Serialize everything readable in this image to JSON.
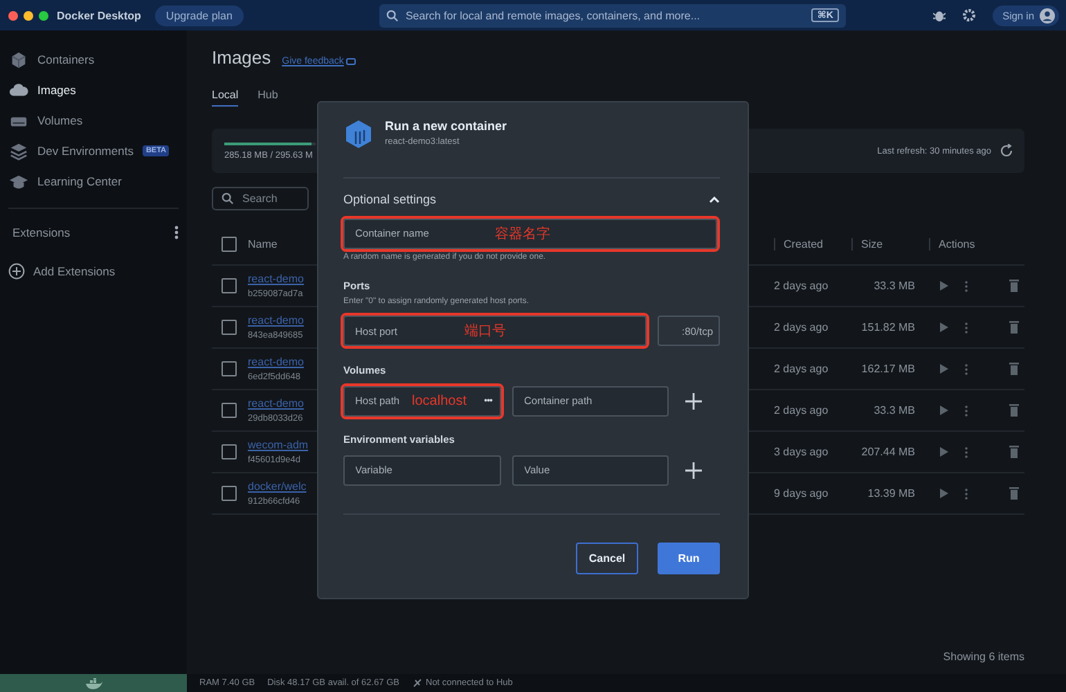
{
  "window": {
    "title": "Docker Desktop"
  },
  "topbar": {
    "upgrade": "Upgrade plan",
    "search": {
      "placeholder": "Search for local and remote images, containers, and more..."
    },
    "shortcut": "⌘K",
    "sign_in": "Sign in"
  },
  "sidebar": {
    "items": [
      {
        "label": "Containers",
        "selected": false
      },
      {
        "label": "Images",
        "selected": true
      },
      {
        "label": "Volumes",
        "selected": false
      },
      {
        "label": "Dev Environments",
        "selected": false,
        "badge": "BETA"
      },
      {
        "label": "Learning Center",
        "selected": false
      }
    ],
    "extensions": {
      "title": "Extensions",
      "add": "Add Extensions"
    }
  },
  "page": {
    "title": "Images",
    "feedback": "Give feedback",
    "tabs": [
      {
        "label": "Local",
        "selected": true
      },
      {
        "label": "Hub",
        "selected": false
      }
    ],
    "storage": {
      "reading": "285.18 MB / 295.63 M",
      "level": 0.96,
      "refresh": "Last refresh: 30 minutes ago"
    },
    "search": {
      "placeholder": "Search"
    },
    "table": {
      "columns": [
        "Name",
        "Created",
        "Size",
        "Actions"
      ],
      "header_checked": false,
      "rows": [
        {
          "name": "react-demo",
          "id": "b259087ad7a",
          "created": "2 days ago",
          "size": "33.3 MB",
          "checked": false
        },
        {
          "name": "react-demo",
          "id": "843ea849685",
          "created": "2 days ago",
          "size": "151.82 MB",
          "checked": false
        },
        {
          "name": "react-demo",
          "id": "6ed2f5dd648",
          "created": "2 days ago",
          "size": "162.17 MB",
          "checked": false
        },
        {
          "name": "react-demo",
          "id": "29db8033d26",
          "created": "2 days ago",
          "size": "33.3 MB",
          "checked": false
        },
        {
          "name": "wecom-adm",
          "id": "f45601d9e4d",
          "created": "3 days ago",
          "size": "207.44 MB",
          "checked": false
        },
        {
          "name": "docker/welc",
          "id": "912b66cfd46",
          "created": "9 days ago",
          "size": "13.39 MB",
          "checked": false
        }
      ]
    },
    "footer": "Showing 6 items"
  },
  "dialog": {
    "title": "Run a new container",
    "subtitle": "react-demo3:latest",
    "section": {
      "title": "Optional settings",
      "expanded": true
    },
    "container_name": {
      "placeholder": "Container name",
      "annotation": "容器名字",
      "highlighted": true
    },
    "name_hint": "A random name is generated if you do not provide one.",
    "ports": {
      "title": "Ports",
      "hint": "Enter \"0\" to assign randomly generated host ports.",
      "host_port": {
        "placeholder": "Host port",
        "annotation": "端口号",
        "highlighted": true
      },
      "container_port": ":80/tcp"
    },
    "volumes": {
      "title": "Volumes",
      "host_path": {
        "placeholder": "Host path",
        "annotation": "localhost",
        "highlighted": true,
        "browse": "•••"
      },
      "container_path": {
        "placeholder": "Container path",
        "highlighted": false
      }
    },
    "env": {
      "title": "Environment variables",
      "variable": {
        "placeholder": "Variable",
        "highlighted": false
      },
      "value": {
        "placeholder": "Value",
        "highlighted": false
      }
    },
    "buttons": [
      {
        "label": "Cancel",
        "kind": "secondary"
      },
      {
        "label": "Run",
        "kind": "primary"
      }
    ]
  },
  "status_bar": {
    "ram": "RAM 7.40 GB",
    "disk": "Disk 48.17 GB avail. of 62.67 GB",
    "hub": "Not connected to Hub"
  }
}
